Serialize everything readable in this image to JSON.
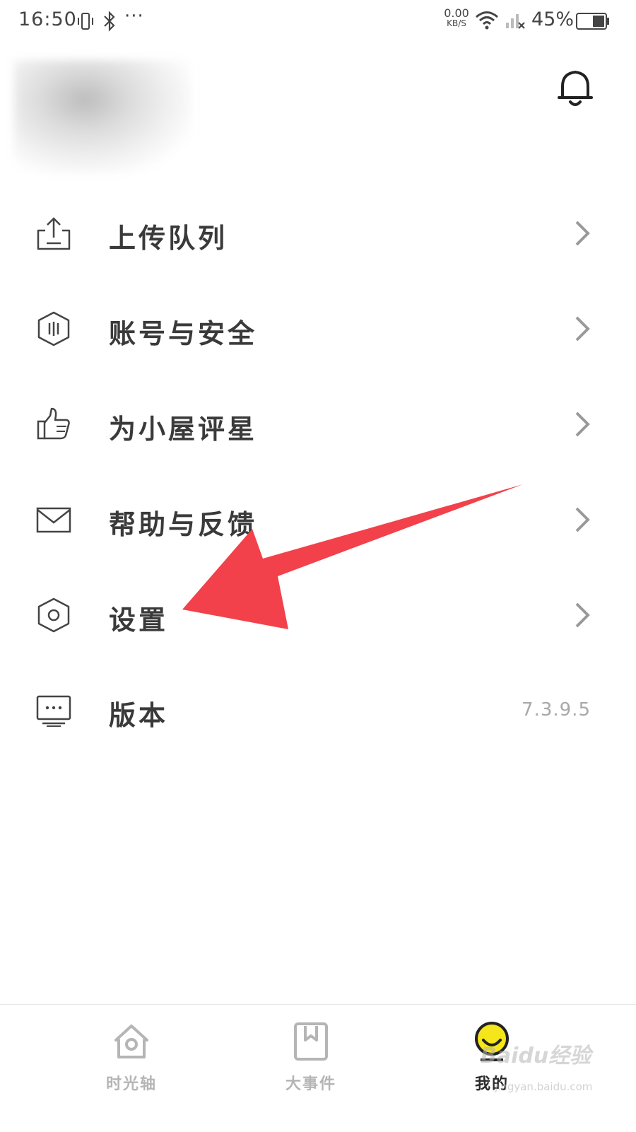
{
  "status_bar": {
    "time": "16:50",
    "more": "···",
    "net_speed_value": "0.00",
    "net_speed_unit": "KB/S",
    "battery_percent": "45%",
    "icons": [
      "vibrate-icon",
      "bluetooth-icon",
      "wifi-icon",
      "signal-icon",
      "battery-icon"
    ]
  },
  "header": {
    "notification_icon": "bell-icon"
  },
  "menu": {
    "items": [
      {
        "label": "上传队列",
        "icon": "upload-icon"
      },
      {
        "label": "账号与安全",
        "icon": "shield-icon"
      },
      {
        "label": "为小屋评星",
        "icon": "thumbs-up-icon"
      },
      {
        "label": "帮助与反馈",
        "icon": "mail-icon"
      },
      {
        "label": "设置",
        "icon": "settings-hexagon-icon"
      },
      {
        "label": "版本",
        "icon": "monitor-icon",
        "value": "7.3.9.5"
      }
    ]
  },
  "annotation": {
    "color": "#f2414a"
  },
  "bottom_nav": {
    "tabs": [
      {
        "label": "时光轴",
        "icon": "home-icon",
        "active": false
      },
      {
        "label": "大事件",
        "icon": "bookmark-icon",
        "active": false
      },
      {
        "label": "我的",
        "icon": "smiley-icon",
        "active": true
      }
    ],
    "active_color": "#f5e51b"
  },
  "watermark": {
    "text": "Baidu经验",
    "sub": "jingyan.baidu.com"
  }
}
